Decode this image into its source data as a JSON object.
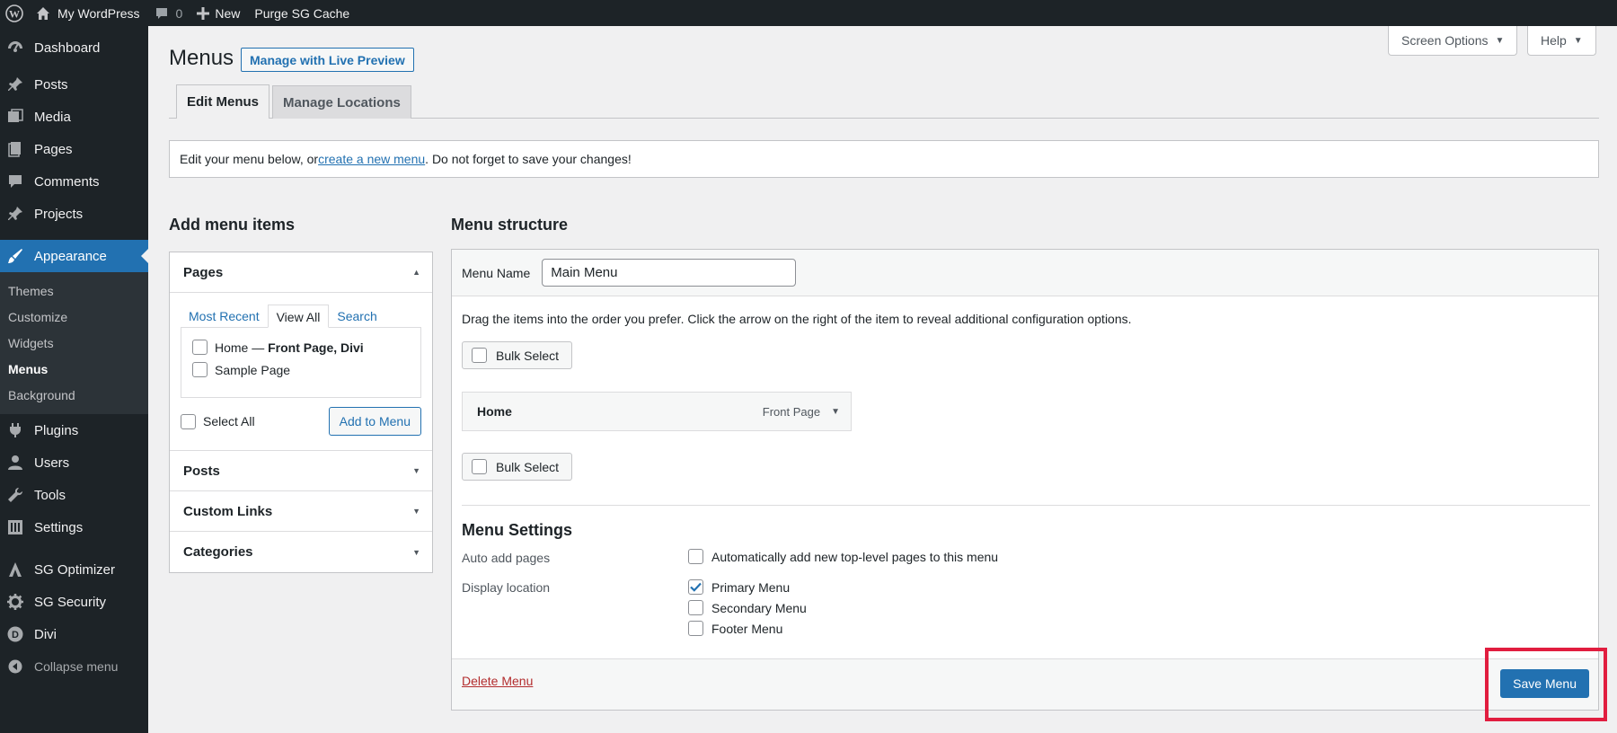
{
  "admin_bar": {
    "site_name": "My WordPress",
    "comments_count": "0",
    "new_label": "New",
    "purge_label": "Purge SG Cache"
  },
  "sidebar": {
    "items_top": [
      {
        "label": "Dashboard",
        "icon": "dashboard-icon"
      }
    ],
    "items_content": [
      {
        "label": "Posts",
        "icon": "pin-icon"
      },
      {
        "label": "Media",
        "icon": "media-icon"
      },
      {
        "label": "Pages",
        "icon": "pages-icon"
      },
      {
        "label": "Comments",
        "icon": "comment-icon"
      },
      {
        "label": "Projects",
        "icon": "pin-icon"
      }
    ],
    "appearance": {
      "label": "Appearance",
      "icon": "brush-icon"
    },
    "submenu": [
      "Themes",
      "Customize",
      "Widgets",
      "Menus",
      "Background"
    ],
    "items_after": [
      {
        "label": "Plugins",
        "icon": "plugin-icon"
      },
      {
        "label": "Users",
        "icon": "user-icon"
      },
      {
        "label": "Tools",
        "icon": "wrench-icon"
      },
      {
        "label": "Settings",
        "icon": "settings-icon"
      }
    ],
    "items_plugins": [
      {
        "label": "SG Optimizer",
        "icon": "sg-optimizer-icon"
      },
      {
        "label": "SG Security",
        "icon": "sg-security-icon"
      },
      {
        "label": "Divi",
        "icon": "divi-icon"
      }
    ],
    "collapse_label": "Collapse menu"
  },
  "header": {
    "screen_options": "Screen Options",
    "help": "Help",
    "title": "Menus",
    "live_preview": "Manage with Live Preview",
    "tab_edit": "Edit Menus",
    "tab_locations": "Manage Locations"
  },
  "notice": {
    "before": "Edit your menu below, or ",
    "link": "create a new menu",
    "after": ". Do not forget to save your changes!"
  },
  "add_items": {
    "heading": "Add menu items",
    "pages_title": "Pages",
    "tabs": [
      "Most Recent",
      "View All",
      "Search"
    ],
    "page_home": "Home — ",
    "page_home_bold": "Front Page, Divi",
    "page_sample": "Sample Page",
    "select_all": "Select All",
    "add_button": "Add to Menu",
    "sections": [
      "Posts",
      "Custom Links",
      "Categories"
    ]
  },
  "structure": {
    "heading": "Menu structure",
    "name_label": "Menu Name",
    "name_value": "Main Menu",
    "instructions": "Drag the items into the order you prefer. Click the arrow on the right of the item to reveal additional configuration options.",
    "bulk_select": "Bulk Select",
    "item_title": "Home",
    "item_meta": "Front Page",
    "settings_heading": "Menu Settings",
    "auto_add_label": "Auto add pages",
    "auto_add_option": "Automatically add new top-level pages to this menu",
    "display_label": "Display location",
    "locations": [
      {
        "label": "Primary Menu",
        "checked": true
      },
      {
        "label": "Secondary Menu",
        "checked": false
      },
      {
        "label": "Footer Menu",
        "checked": false
      }
    ],
    "delete_link": "Delete Menu",
    "save_button": "Save Menu"
  }
}
